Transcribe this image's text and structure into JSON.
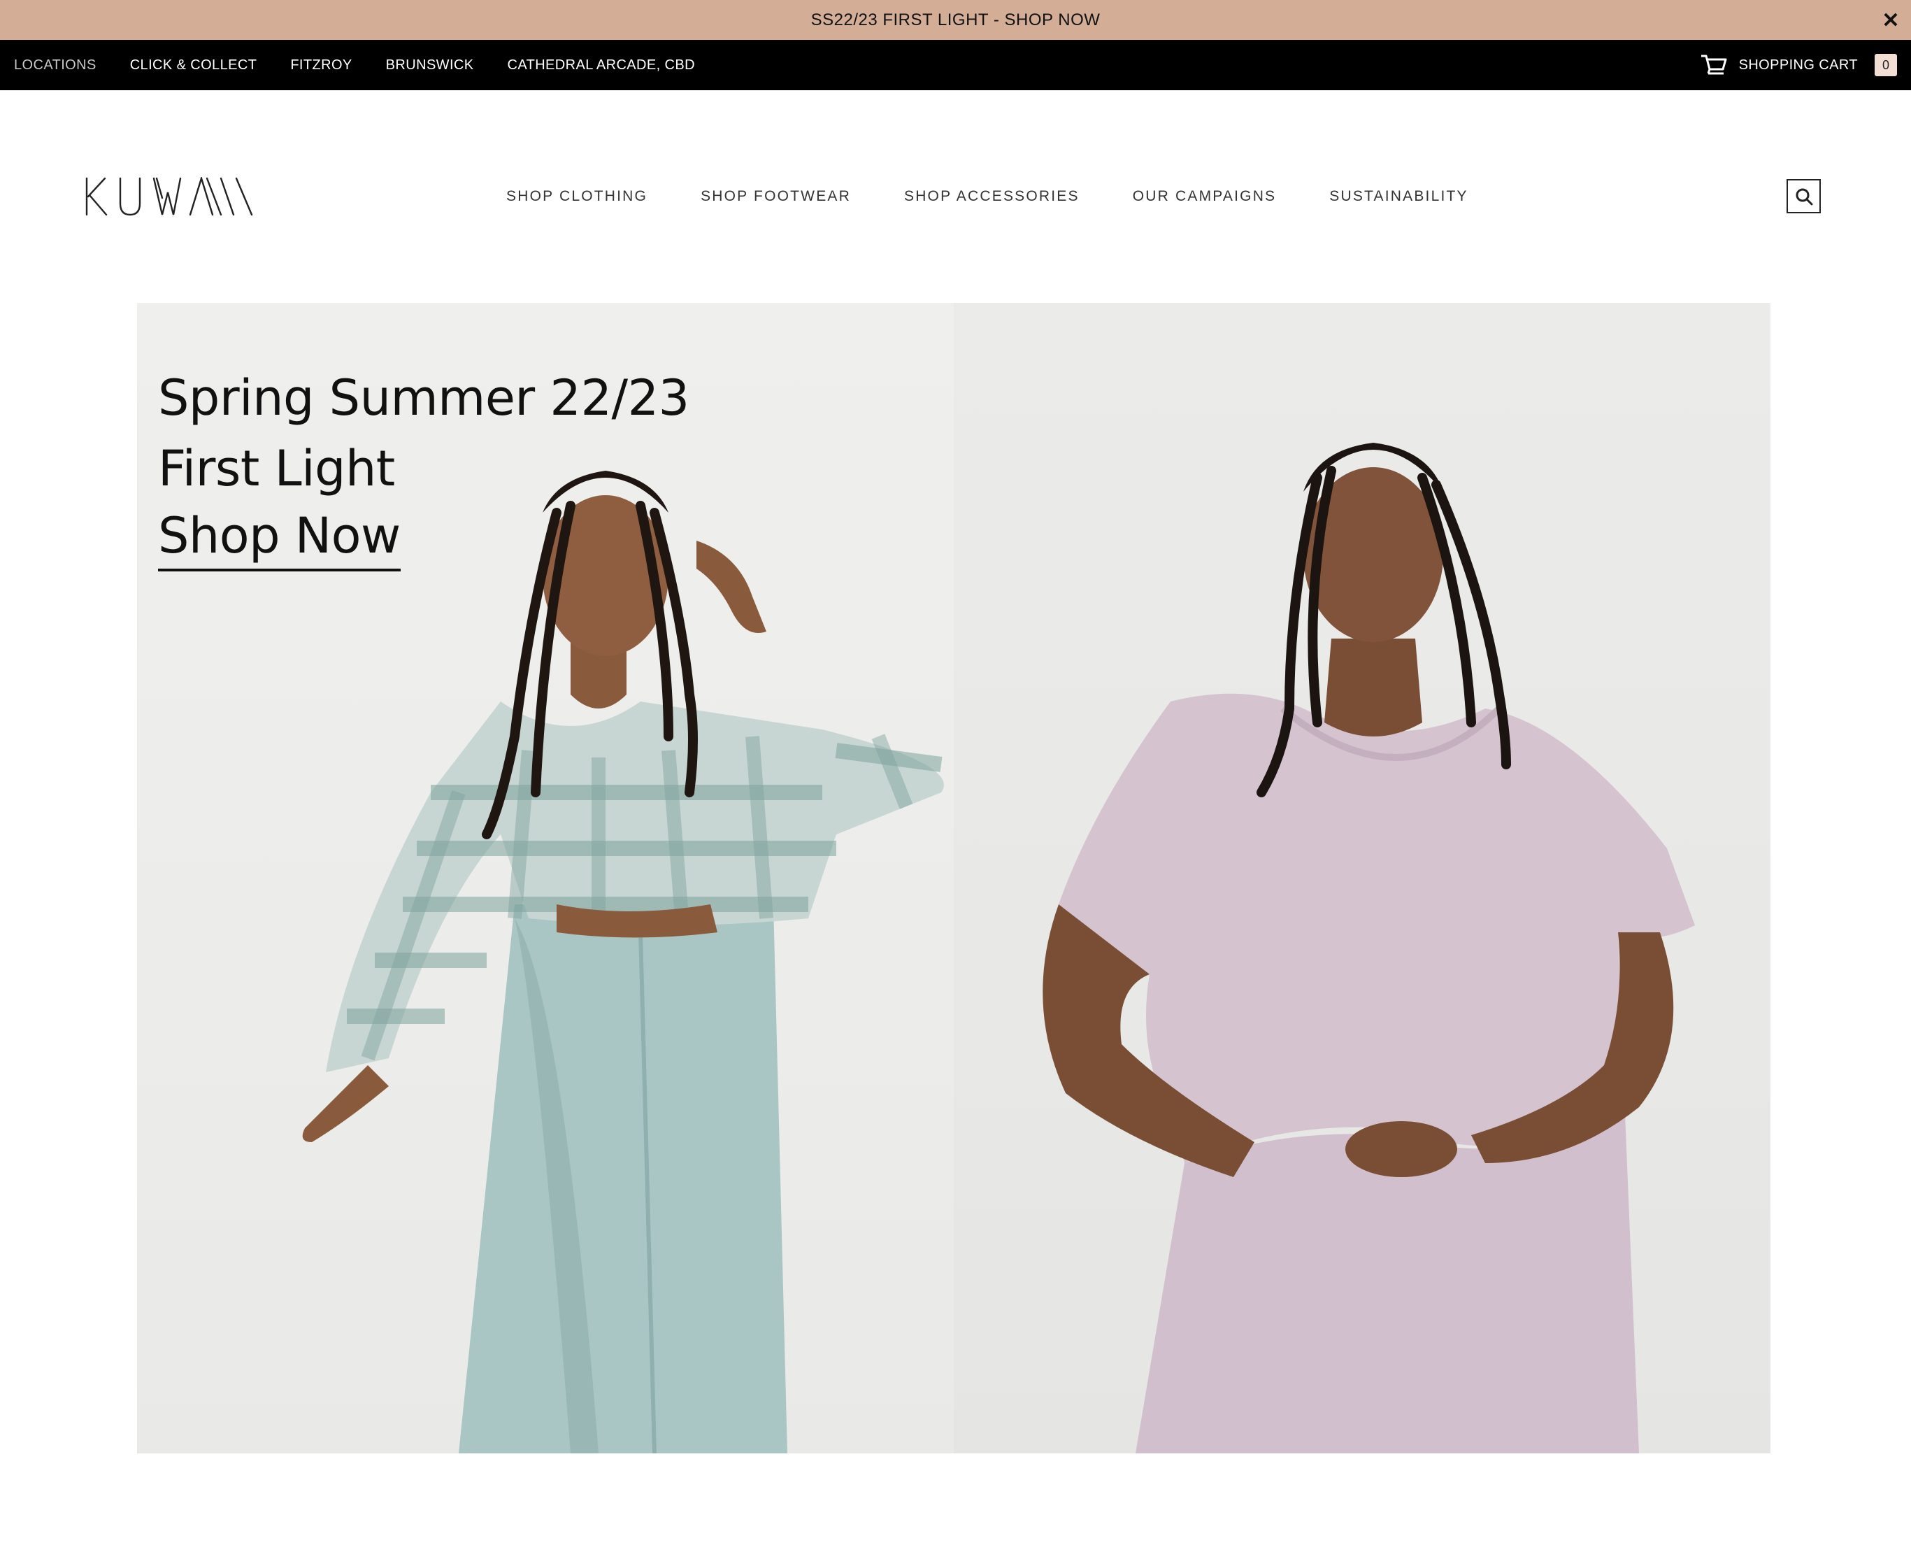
{
  "announcement": {
    "text": "SS22/23 FIRST LIGHT - SHOP NOW",
    "close_icon": "close-icon",
    "background": "#d4ad96"
  },
  "topbar": {
    "links": [
      "LOCATIONS",
      "CLICK & COLLECT",
      "FITZROY",
      "BRUNSWICK",
      "CATHEDRAL ARCADE, CBD"
    ],
    "cart_icon": "shopping-cart-icon",
    "cart_label": "SHOPPING CART",
    "cart_count": "0"
  },
  "header": {
    "logo_text": "KUWAAI",
    "nav": [
      "SHOP CLOTHING",
      "SHOP FOOTWEAR",
      "SHOP ACCESSORIES",
      "OUR CAMPAIGNS",
      "SUSTAINABILITY"
    ],
    "search_icon": "search-icon"
  },
  "hero": {
    "line1": "Spring Summer 22/23",
    "line2": "First Light",
    "cta": "Shop Now",
    "left_image": "model in gingham blouse and sage wide-leg trousers",
    "right_image": "model in lilac linen tee"
  }
}
